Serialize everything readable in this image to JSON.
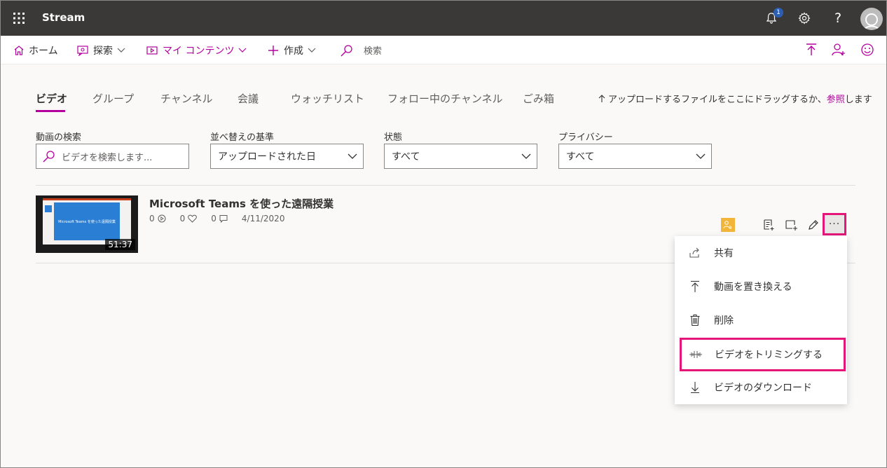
{
  "app": {
    "title": "Stream",
    "notification_count": "1"
  },
  "nav": {
    "home": "ホーム",
    "explore": "探索",
    "my_content": "マイ コンテンツ",
    "create": "作成",
    "search": "検索"
  },
  "tabs": [
    "ビデオ",
    "グループ",
    "チャンネル",
    "会議",
    "ウォッチリスト",
    "フォロー中のチャンネル",
    "ごみ箱"
  ],
  "upload_hint": {
    "prefix": "アップロードするファイルをここにドラッグするか、",
    "link": "参照",
    "suffix": "します"
  },
  "filters": {
    "search_label": "動画の検索",
    "search_placeholder": "ビデオを検索します...",
    "sort_label": "並べ替えの基準",
    "sort_value": "アップロードされた日",
    "state_label": "状態",
    "state_value": "すべて",
    "privacy_label": "プライバシー",
    "privacy_value": "すべて"
  },
  "video": {
    "title": "Microsoft Teams を使った遠隔授業",
    "views": "0",
    "likes": "0",
    "comments": "0",
    "date": "4/11/2020",
    "duration": "51:37",
    "thumb_text": "Microsoft Teams を使った遠隔授業",
    "more_label": "···"
  },
  "menu": {
    "share": "共有",
    "replace": "動画を置き換える",
    "delete": "削除",
    "trim": "ビデオをトリミングする",
    "download": "ビデオのダウンロード"
  },
  "colors": {
    "accent": "#b4009e",
    "highlight": "#e6157a",
    "topbar": "#3a3938"
  }
}
